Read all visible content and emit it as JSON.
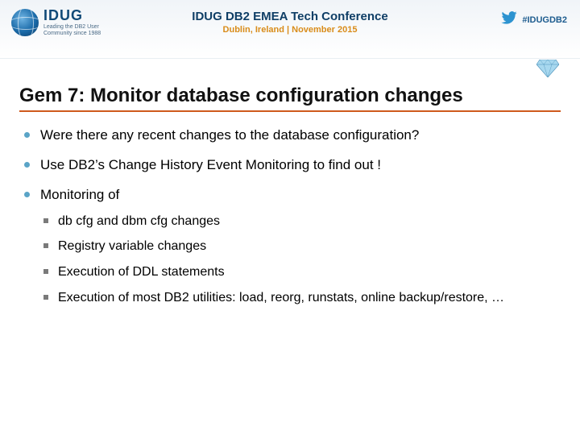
{
  "header": {
    "logo_word": "IDUG",
    "logo_tagline": "Leading the DB2 User Community since 1988",
    "conference_title": "IDUG DB2 EMEA Tech Conference",
    "conference_subtitle": "Dublin, Ireland | November 2015",
    "twitter_hashtag": "#IDUGDB2"
  },
  "slide": {
    "title": "Gem 7: Monitor database configuration changes",
    "bullets": [
      {
        "text": "Were there any recent changes to the database configuration?"
      },
      {
        "text": "Use DB2’s Change History Event Monitoring to find out !"
      },
      {
        "text": "Monitoring of",
        "sub": [
          "db cfg and dbm cfg changes",
          "Registry variable changes",
          "Execution of DDL statements",
          "Execution of most DB2 utilities: load, reorg, runstats, online backup/restore, …"
        ]
      }
    ]
  }
}
